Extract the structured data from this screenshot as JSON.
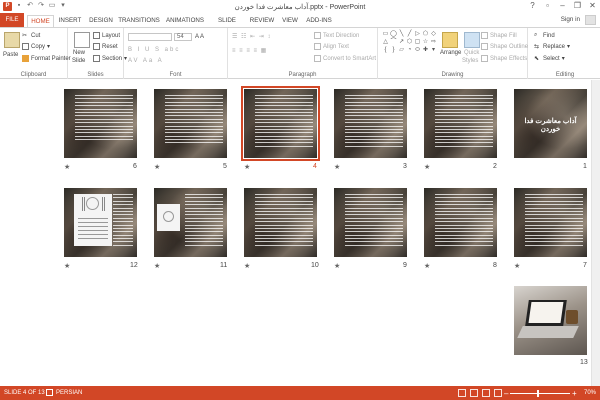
{
  "window": {
    "title": "آداب معاشرت فدا خوردن.pptx - PowerPoint",
    "app_icon_label": "P",
    "buttons": {
      "help": "?",
      "minimize": "–",
      "restore": "❐",
      "close": "✕"
    }
  },
  "tabs": [
    {
      "label": "FILE"
    },
    {
      "label": "HOME"
    },
    {
      "label": "INSERT"
    },
    {
      "label": "DESIGN"
    },
    {
      "label": "TRANSITIONS"
    },
    {
      "label": "ANIMATIONS"
    },
    {
      "label": "SLIDE SHOW"
    },
    {
      "label": "REVIEW"
    },
    {
      "label": "VIEW"
    },
    {
      "label": "ADD-INS"
    }
  ],
  "signin": "Sign in",
  "ribbon": {
    "clipboard": {
      "label": "Clipboard",
      "paste": "Paste",
      "cut": "Cut",
      "copy": "Copy",
      "format_painter": "Format Painter"
    },
    "slides": {
      "label": "Slides",
      "new_slide": "New",
      "new_slide2": "Slide",
      "layout": "Layout",
      "reset": "Reset",
      "section": "Section"
    },
    "font": {
      "label": "Font",
      "size": "54"
    },
    "paragraph": {
      "label": "Paragraph",
      "text_direction": "Text Direction",
      "align_text": "Align Text",
      "convert": "Convert to SmartArt"
    },
    "drawing": {
      "label": "Drawing",
      "arrange": "Arrange",
      "quick_styles": "Quick",
      "quick_styles2": "Styles",
      "shape_fill": "Shape Fill",
      "shape_outline": "Shape Outline",
      "shape_effects": "Shape Effects"
    },
    "editing": {
      "label": "Editing",
      "find": "Find",
      "replace": "Replace",
      "select": "Select"
    }
  },
  "slides": [
    {
      "number": "1",
      "title": "آداب معاشرت فدا خوردن"
    },
    {
      "number": "2"
    },
    {
      "number": "3"
    },
    {
      "number": "4"
    },
    {
      "number": "5"
    },
    {
      "number": "6"
    },
    {
      "number": "7"
    },
    {
      "number": "8"
    },
    {
      "number": "9"
    },
    {
      "number": "10"
    },
    {
      "number": "11"
    },
    {
      "number": "12"
    },
    {
      "number": "13"
    }
  ],
  "selected_slide": "4",
  "status": {
    "slide_info": "SLIDE 4 OF 13",
    "language": "PERSIAN",
    "zoom": "70%",
    "zoom_fraction": 0.47,
    "zoom_minus": "–",
    "zoom_plus": "+"
  },
  "colors": {
    "accent": "#d24726"
  }
}
